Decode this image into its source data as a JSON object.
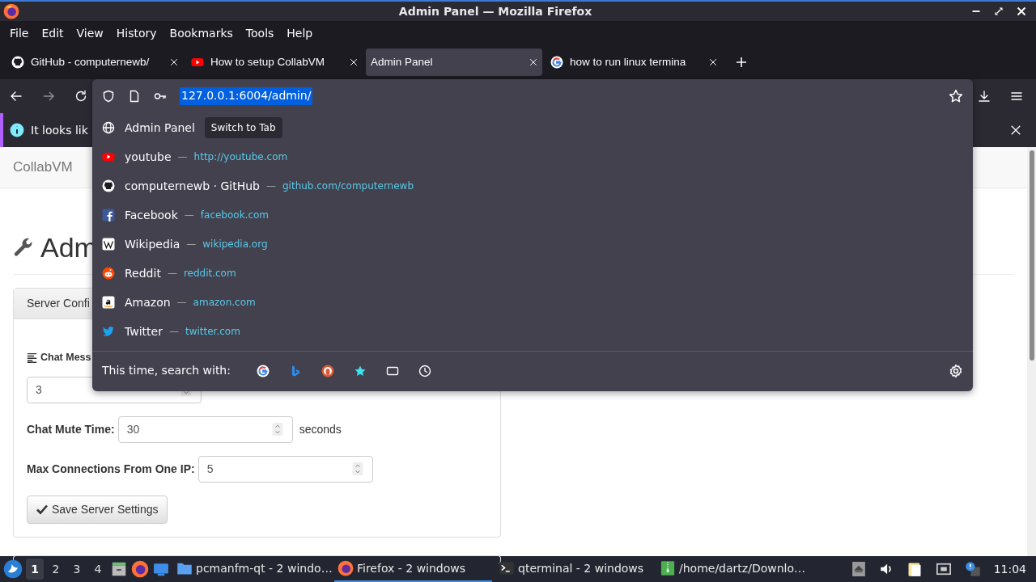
{
  "window": {
    "title": "Admin Panel — Mozilla Firefox"
  },
  "menu": [
    "File",
    "Edit",
    "View",
    "History",
    "Bookmarks",
    "Tools",
    "Help"
  ],
  "tabs": [
    {
      "label": "GitHub - computernewb/",
      "kind": "github",
      "selected": false
    },
    {
      "label": "How to setup CollabVM",
      "kind": "youtube",
      "selected": false
    },
    {
      "label": "Admin Panel",
      "kind": "none",
      "selected": true
    },
    {
      "label": "how to run linux termina",
      "kind": "google",
      "selected": false
    }
  ],
  "address_bar": {
    "url": "127.0.0.1:6004/admin/",
    "url_selected": true
  },
  "notification": {
    "text": "It looks lik"
  },
  "suggestions": [
    {
      "kind": "globe",
      "title": "Admin Panel",
      "action": "Switch to Tab"
    },
    {
      "kind": "youtube",
      "title": "youtube",
      "separator": "—",
      "url": "http://youtube.com"
    },
    {
      "kind": "github",
      "title": "computernewb · GitHub",
      "separator": "—",
      "url": "github.com/computernewb"
    },
    {
      "kind": "facebook",
      "title": "Facebook",
      "separator": "—",
      "url": "facebook.com"
    },
    {
      "kind": "wikipedia",
      "title": "Wikipedia",
      "separator": "—",
      "url": "wikipedia.org"
    },
    {
      "kind": "reddit",
      "title": "Reddit",
      "separator": "—",
      "url": "reddit.com"
    },
    {
      "kind": "amazon",
      "title": "Amazon",
      "separator": "—",
      "url": "amazon.com"
    },
    {
      "kind": "twitter",
      "title": "Twitter",
      "separator": "—",
      "url": "twitter.com"
    }
  ],
  "search_with": {
    "label": "This time, search with:"
  },
  "page": {
    "brand": "CollabVM",
    "heading": "Adm",
    "card_header": "Server Confi",
    "section_label": "Chat Mess",
    "fields": [
      {
        "value": "3"
      },
      {
        "label": "Chat Mute Time:",
        "value": "30",
        "unit": "seconds"
      },
      {
        "label": "Max Connections From One IP:",
        "value": "5"
      }
    ],
    "save_button": "Save Server Settings"
  },
  "taskbar": {
    "workspaces": [
      {
        "label": "1",
        "selected": true
      },
      {
        "label": "2",
        "selected": false
      },
      {
        "label": "3",
        "selected": false
      },
      {
        "label": "4",
        "selected": false
      }
    ],
    "tasks": [
      {
        "label": "pcmanfm-qt - 2 windo…",
        "kind": "folder",
        "selected": false
      },
      {
        "label": "Firefox - 2 windows",
        "kind": "firefox",
        "selected": true
      },
      {
        "label": "qterminal - 2 windows",
        "kind": "terminal",
        "selected": false
      },
      {
        "label": "/home/dartz/Downlo…",
        "kind": "archive",
        "selected": false
      }
    ],
    "clock": "11:04"
  }
}
